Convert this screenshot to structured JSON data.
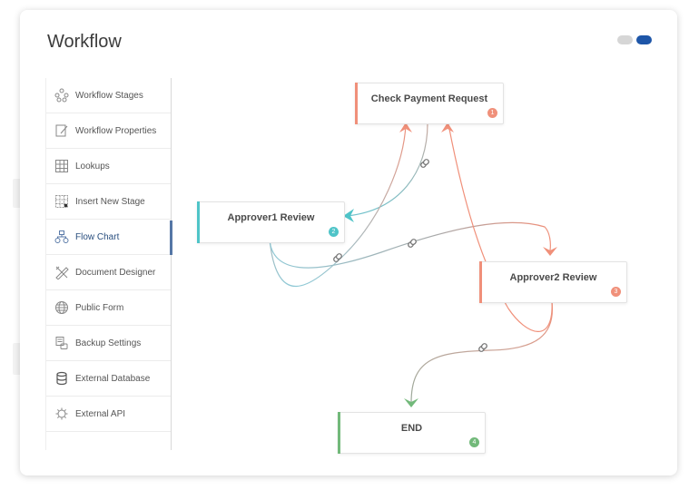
{
  "header": {
    "title": "Workflow"
  },
  "toggles": [
    {
      "state": "off",
      "color": "#d6d6d6"
    },
    {
      "state": "on",
      "color": "#1e56a8"
    }
  ],
  "sidebar": {
    "items": [
      {
        "label": "Workflow Stages",
        "icon": "workflow-stages-icon",
        "active": false
      },
      {
        "label": "Workflow Properties",
        "icon": "edit-document-icon",
        "active": false
      },
      {
        "label": "Lookups",
        "icon": "grid-icon",
        "active": false
      },
      {
        "label": "Insert New Stage",
        "icon": "insert-stage-icon",
        "active": false
      },
      {
        "label": "Flow Chart",
        "icon": "flow-chart-icon",
        "active": true
      },
      {
        "label": "Document Designer",
        "icon": "design-tools-icon",
        "active": false
      },
      {
        "label": "Public Form",
        "icon": "globe-icon",
        "active": false
      },
      {
        "label": "Backup Settings",
        "icon": "backup-icon",
        "active": false
      },
      {
        "label": "External Database",
        "icon": "database-icon",
        "active": false
      },
      {
        "label": "External API",
        "icon": "api-gear-icon",
        "active": false
      }
    ]
  },
  "flowchart": {
    "nodes": [
      {
        "id": 1,
        "name": "Check Payment Request",
        "badge": "1",
        "color": "#f0907a"
      },
      {
        "id": 2,
        "name": "Approver1 Review",
        "badge": "2",
        "color": "#4fc4c8"
      },
      {
        "id": 3,
        "name": "Approver2 Review",
        "badge": "3",
        "color": "#f0907a"
      },
      {
        "id": 4,
        "name": "END",
        "badge": "4",
        "color": "#72b97a"
      }
    ],
    "connections": [
      {
        "from": 1,
        "to": 2
      },
      {
        "from": 2,
        "to": 1
      },
      {
        "from": 2,
        "to": 3
      },
      {
        "from": 3,
        "to": 1
      },
      {
        "from": 3,
        "to": 4
      }
    ]
  }
}
